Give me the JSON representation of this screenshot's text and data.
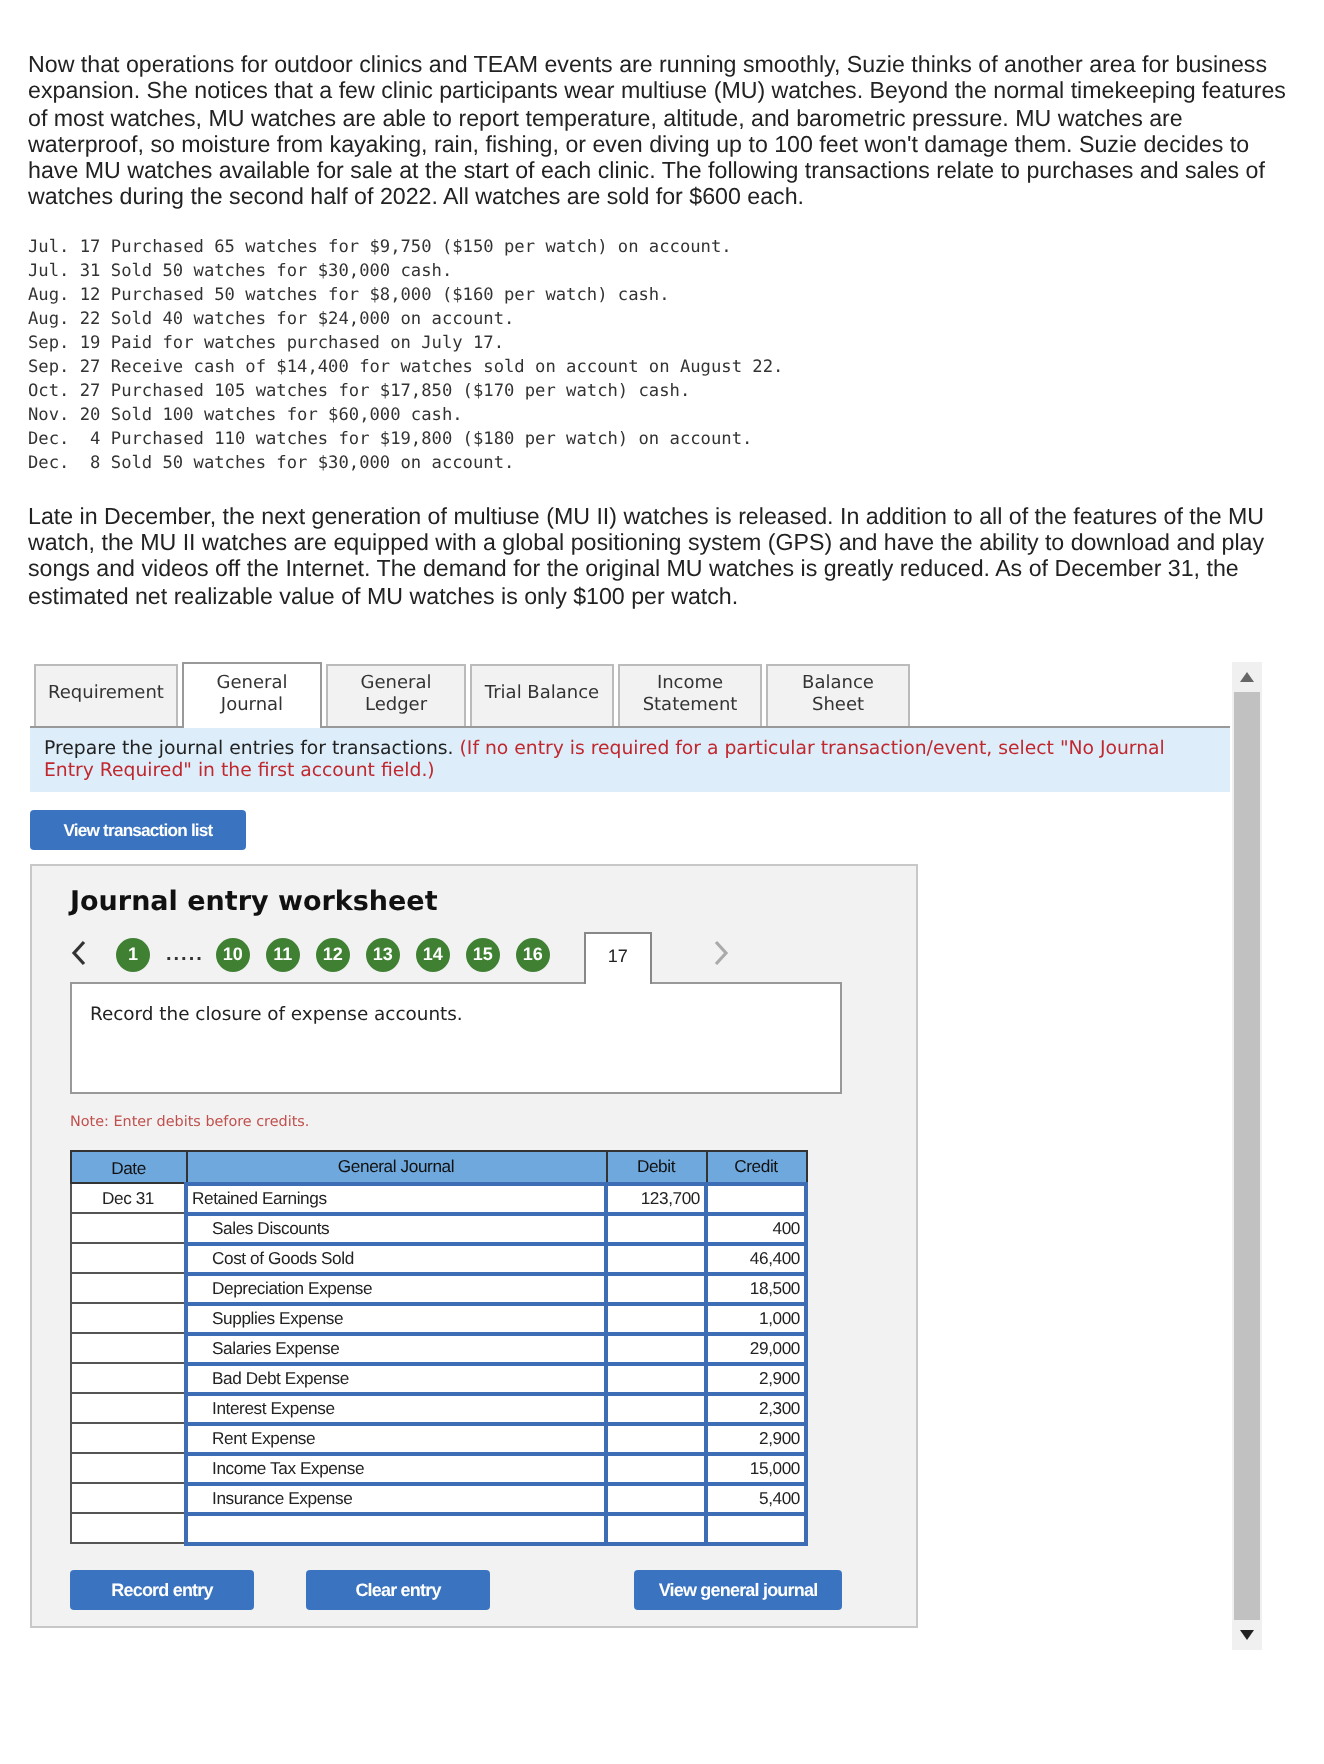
{
  "intro": "Now that operations for outdoor clinics and TEAM events are running smoothly, Suzie thinks of another area for business expansion. She notices that a few clinic participants wear multiuse (MU) watches. Beyond the normal timekeeping features of most watches, MU watches are able to report temperature, altitude, and barometric pressure. MU watches are waterproof, so moisture from kayaking, rain, fishing, or even diving up to 100 feet won't damage them. Suzie decides to have MU watches available for sale at the start of each clinic. The following transactions relate to purchases and sales of watches during the second half of 2022. All watches are sold for $600 each.",
  "transactions": [
    {
      "date": "Jul. 17",
      "text": "Purchased 65 watches for $9,750 ($150 per watch) on account."
    },
    {
      "date": "Jul. 31",
      "text": "Sold 50 watches for $30,000 cash."
    },
    {
      "date": "Aug. 12",
      "text": "Purchased 50 watches for $8,000 ($160 per watch) cash."
    },
    {
      "date": "Aug. 22",
      "text": "Sold 40 watches for $24,000 on account."
    },
    {
      "date": "Sep. 19",
      "text": "Paid for watches purchased on July 17."
    },
    {
      "date": "Sep. 27",
      "text": "Receive cash of $14,400 for watches sold on account on August 22."
    },
    {
      "date": "Oct. 27",
      "text": "Purchased 105 watches for $17,850 ($170 per watch) cash."
    },
    {
      "date": "Nov. 20",
      "text": "Sold 100 watches for $60,000 cash."
    },
    {
      "date": "Dec.  4",
      "text": "Purchased 110 watches for $19,800 ($180 per watch) on account."
    },
    {
      "date": "Dec.  8",
      "text": "Sold 50 watches for $30,000 on account."
    }
  ],
  "closing": "Late in December, the next generation of multiuse (MU II) watches is released. In addition to all of the features of the MU watch, the MU II watches are equipped with a global positioning system (GPS) and have the ability to download and play songs and videos off the Internet. The demand for the original MU watches is greatly reduced. As of December 31, the estimated net realizable value of MU watches is only $100 per watch.",
  "tabs": [
    {
      "label": "Requirement",
      "selected": false
    },
    {
      "label": "General Journal",
      "selected": true
    },
    {
      "label": "General Ledger",
      "selected": false
    },
    {
      "label": "Trial Balance",
      "selected": false
    },
    {
      "label": "Income Statement",
      "selected": false
    },
    {
      "label": "Balance Sheet",
      "selected": false
    }
  ],
  "instruction": {
    "text": "Prepare the journal entries for transactions.",
    "note": "(If no entry is required for a particular transaction/event, select \"No Journal Entry Required\" in the first account field.)"
  },
  "view_transaction_button": "View transaction list",
  "worksheet": {
    "title": "Journal entry worksheet",
    "pager": [
      {
        "kind": "step",
        "label": "1",
        "selected": false
      },
      {
        "kind": "gap",
        "label": "....."
      },
      {
        "kind": "step",
        "label": "10",
        "selected": false
      },
      {
        "kind": "step",
        "label": "11",
        "selected": false
      },
      {
        "kind": "step",
        "label": "12",
        "selected": false
      },
      {
        "kind": "step",
        "label": "13",
        "selected": false
      },
      {
        "kind": "step",
        "label": "14",
        "selected": false
      },
      {
        "kind": "step",
        "label": "15",
        "selected": false
      },
      {
        "kind": "step",
        "label": "16",
        "selected": false
      },
      {
        "kind": "step",
        "label": "17",
        "selected": true
      }
    ],
    "description": "Record the closure of expense accounts.",
    "note": "Note: Enter debits before credits.",
    "columns": [
      "Date",
      "General Journal",
      "Debit",
      "Credit"
    ],
    "rows": [
      {
        "date": "Dec 31",
        "account": "Retained Earnings",
        "indented": false,
        "debit": "123,700",
        "credit": ""
      },
      {
        "date": "",
        "account": "Sales Discounts",
        "indented": true,
        "debit": "",
        "credit": "400"
      },
      {
        "date": "",
        "account": "Cost of Goods Sold",
        "indented": true,
        "debit": "",
        "credit": "46,400"
      },
      {
        "date": "",
        "account": "Depreciation Expense",
        "indented": true,
        "debit": "",
        "credit": "18,500"
      },
      {
        "date": "",
        "account": "Supplies Expense",
        "indented": true,
        "debit": "",
        "credit": "1,000"
      },
      {
        "date": "",
        "account": "Salaries Expense",
        "indented": true,
        "debit": "",
        "credit": "29,000"
      },
      {
        "date": "",
        "account": "Bad Debt Expense",
        "indented": true,
        "debit": "",
        "credit": "2,900"
      },
      {
        "date": "",
        "account": "Interest Expense",
        "indented": true,
        "debit": "",
        "credit": "2,300"
      },
      {
        "date": "",
        "account": "Rent Expense",
        "indented": true,
        "debit": "",
        "credit": "2,900"
      },
      {
        "date": "",
        "account": "Income Tax Expense",
        "indented": true,
        "debit": "",
        "credit": "15,000"
      },
      {
        "date": "",
        "account": "Insurance Expense",
        "indented": true,
        "debit": "",
        "credit": "5,400"
      },
      {
        "date": "",
        "account": "",
        "debit": "",
        "credit": ""
      }
    ],
    "buttons": [
      "Record entry",
      "Clear entry",
      "View general journal"
    ]
  }
}
